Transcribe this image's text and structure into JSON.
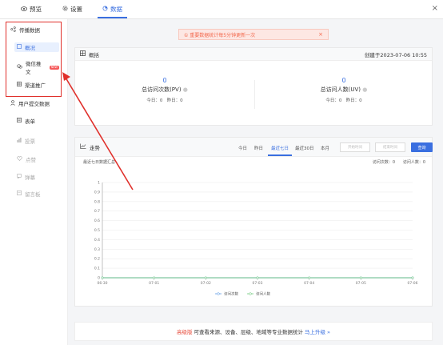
{
  "tabs": [
    {
      "label": "预览",
      "icon": "eye-icon"
    },
    {
      "label": "设置",
      "icon": "gear-icon"
    },
    {
      "label": "数据",
      "icon": "pie-chart-icon"
    }
  ],
  "close_symbol": "×",
  "sidebar": {
    "group1": {
      "label": "传播数据",
      "icon": "share-icon"
    },
    "items1": [
      {
        "label": "概况",
        "icon": "overview-icon"
      },
      {
        "label": "微信推文",
        "badge": "NEW",
        "icon": "wechat-icon"
      },
      {
        "label": "渠道推广",
        "icon": "grid-icon"
      }
    ],
    "group2": {
      "label": "用户提交数据",
      "icon": "user-icon"
    },
    "items2": [
      {
        "label": "表单",
        "icon": "form-icon"
      },
      {
        "label": "投票",
        "icon": "bar-icon"
      },
      {
        "label": "点赞",
        "icon": "heart-icon"
      },
      {
        "label": "弹幕",
        "icon": "danmu-icon"
      },
      {
        "label": "留言板",
        "icon": "board-icon"
      }
    ]
  },
  "notice": {
    "text": "①  重要数据统计每5分钟更新一次",
    "close": "×"
  },
  "overview": {
    "title": "概括",
    "created": "创建于2023-07-06 10:55",
    "pv": {
      "value": "0",
      "label": "总访问次数(PV)",
      "today": "今日：0",
      "yesterday": "昨日：0"
    },
    "uv": {
      "value": "0",
      "label": "总访问人数(UV)",
      "today": "今日：0",
      "yesterday": "昨日：0"
    }
  },
  "trend": {
    "title": "走势",
    "ranges": [
      "今日",
      "昨日",
      "最近七日",
      "最近30日",
      "本月"
    ],
    "start_placeholder": "开始时间",
    "end_placeholder": "结束时间",
    "query": "查询",
    "caption": "最近七日数据汇总",
    "visits": "访问次数：0",
    "visitors": "访问人数：0"
  },
  "chart_data": {
    "type": "line",
    "x": [
      "06-30",
      "07-01",
      "07-02",
      "07-03",
      "07-04",
      "07-05",
      "07-06"
    ],
    "ylim": [
      0,
      1
    ],
    "yticks": [
      "0",
      "0.1",
      "0.2",
      "0.3",
      "0.4",
      "0.5",
      "0.6",
      "0.7",
      "0.8",
      "0.9",
      "1"
    ],
    "series": [
      {
        "name": "访问次数",
        "color": "#4a90e2",
        "values": [
          0,
          0,
          0,
          0,
          0,
          0,
          0
        ]
      },
      {
        "name": "访问人数",
        "color": "#5cc26b",
        "values": [
          0,
          0,
          0,
          0,
          0,
          0,
          0
        ]
      }
    ]
  },
  "upgrade": {
    "prefix": "高级版",
    "text": "可查看来源、设备、层级、地域等专业数据统计",
    "link": "马上升级 »"
  }
}
